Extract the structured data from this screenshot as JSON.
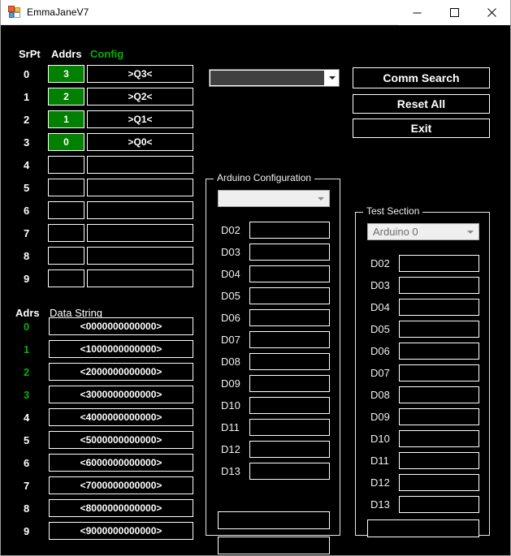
{
  "window": {
    "title": "EmmaJaneV7",
    "icon": "app-form-icon",
    "controls": {
      "minimize": "minimize-icon",
      "maximize": "maximize-icon",
      "close": "close-icon"
    }
  },
  "colors": {
    "background": "#000000",
    "text": "#ffffff",
    "accent_green": "#00b400",
    "fill_green": "#018001",
    "border": "#ffffff",
    "group_border": "#e8e8e8",
    "combo_dark_field": "#404040",
    "combo_light_bg": "#efefef",
    "combo_light_text": "#6d6d6d"
  },
  "srpt_table": {
    "headers": {
      "srpt": "SrPt",
      "addrs": "Addrs",
      "config": "Config"
    },
    "rows": [
      {
        "srpt": "0",
        "addr": "3",
        "addr_filled": true,
        "config": ">Q3<"
      },
      {
        "srpt": "1",
        "addr": "2",
        "addr_filled": true,
        "config": ">Q2<"
      },
      {
        "srpt": "2",
        "addr": "1",
        "addr_filled": true,
        "config": ">Q1<"
      },
      {
        "srpt": "3",
        "addr": "0",
        "addr_filled": true,
        "config": ">Q0<"
      },
      {
        "srpt": "4",
        "addr": "",
        "addr_filled": false,
        "config": ""
      },
      {
        "srpt": "5",
        "addr": "",
        "addr_filled": false,
        "config": ""
      },
      {
        "srpt": "6",
        "addr": "",
        "addr_filled": false,
        "config": ""
      },
      {
        "srpt": "7",
        "addr": "",
        "addr_filled": false,
        "config": ""
      },
      {
        "srpt": "8",
        "addr": "",
        "addr_filled": false,
        "config": ""
      },
      {
        "srpt": "9",
        "addr": "",
        "addr_filled": false,
        "config": ""
      }
    ]
  },
  "data_string_table": {
    "headers": {
      "adrs": "Adrs",
      "data_string": "Data String"
    },
    "rows": [
      {
        "adrs": "0",
        "adrs_green": true,
        "value": "<0000000000000>"
      },
      {
        "adrs": "1",
        "adrs_green": true,
        "value": "<1000000000000>"
      },
      {
        "adrs": "2",
        "adrs_green": true,
        "value": "<2000000000000>"
      },
      {
        "adrs": "3",
        "adrs_green": true,
        "value": "<3000000000000>"
      },
      {
        "adrs": "4",
        "adrs_green": false,
        "value": "<4000000000000>"
      },
      {
        "adrs": "5",
        "adrs_green": false,
        "value": "<5000000000000>"
      },
      {
        "adrs": "6",
        "adrs_green": false,
        "value": "<6000000000000>"
      },
      {
        "adrs": "7",
        "adrs_green": false,
        "value": "<7000000000000>"
      },
      {
        "adrs": "8",
        "adrs_green": false,
        "value": "<8000000000000>"
      },
      {
        "adrs": "9",
        "adrs_green": false,
        "value": "<9000000000000>"
      }
    ]
  },
  "top_combo": {
    "value": "",
    "arrow": "chevron-down-icon"
  },
  "action_buttons": {
    "comm_search": "Comm Search",
    "reset_all": "Reset All",
    "exit": "Exit"
  },
  "arduino_config": {
    "title": "Arduino Configuration",
    "combo_value": "",
    "pins": [
      {
        "label": "D02",
        "value": ""
      },
      {
        "label": "D03",
        "value": ""
      },
      {
        "label": "D04",
        "value": ""
      },
      {
        "label": "D05",
        "value": ""
      },
      {
        "label": "D06",
        "value": ""
      },
      {
        "label": "D07",
        "value": ""
      },
      {
        "label": "D08",
        "value": ""
      },
      {
        "label": "D09",
        "value": ""
      },
      {
        "label": "D10",
        "value": ""
      },
      {
        "label": "D11",
        "value": ""
      },
      {
        "label": "D12",
        "value": ""
      },
      {
        "label": "D13",
        "value": ""
      }
    ],
    "extra_fields": [
      {
        "value": ""
      },
      {
        "value": ""
      }
    ]
  },
  "test_section": {
    "title": "Test Section",
    "combo_value": "Arduino 0",
    "pins": [
      {
        "label": "D02",
        "value": ""
      },
      {
        "label": "D03",
        "value": ""
      },
      {
        "label": "D04",
        "value": ""
      },
      {
        "label": "D05",
        "value": ""
      },
      {
        "label": "D06",
        "value": ""
      },
      {
        "label": "D07",
        "value": ""
      },
      {
        "label": "D08",
        "value": ""
      },
      {
        "label": "D09",
        "value": ""
      },
      {
        "label": "D10",
        "value": ""
      },
      {
        "label": "D11",
        "value": ""
      },
      {
        "label": "D12",
        "value": ""
      },
      {
        "label": "D13",
        "value": ""
      }
    ],
    "extra_fields": [
      {
        "value": ""
      }
    ]
  }
}
